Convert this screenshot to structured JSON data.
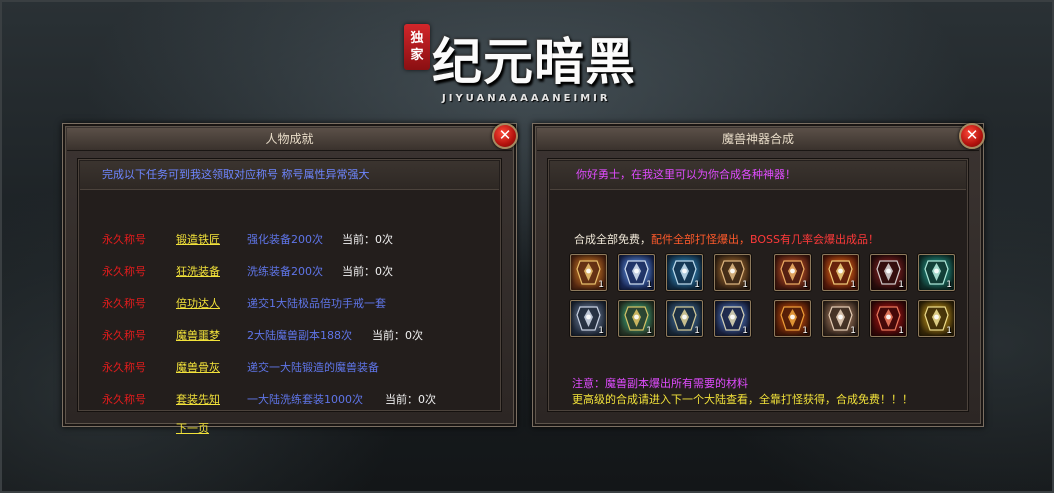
{
  "logo": {
    "seal_1": "独",
    "seal_2": "家",
    "title": "纪元暗黑",
    "subtitle": "JIYUANAAAAANEIMIR"
  },
  "close_glyph": "✕",
  "achievements_panel": {
    "title": "人物成就",
    "banner": "完成以下任务可到我这领取对应称号 称号属性异常强大",
    "rows": [
      {
        "title": "永久称号",
        "name": "锻造铁匠",
        "desc": "强化装备200次",
        "progress": "当前：0次"
      },
      {
        "title": "永久称号",
        "name": "狂洗装备",
        "desc": "洗练装备200次",
        "progress": "当前：0次"
      },
      {
        "title": "永久称号",
        "name": "倍功达人",
        "desc": "递交1大陆极品倍功手戒一套",
        "progress": ""
      },
      {
        "title": "永久称号",
        "name": "魔兽噩梦",
        "desc": "2大陆魔兽副本188次",
        "progress": "当前：0次"
      },
      {
        "title": "永久称号",
        "name": "魔兽骨灰",
        "desc": "递交一大陆锻造的魔兽装备",
        "progress": ""
      },
      {
        "title": "永久称号",
        "name": "套装先知",
        "desc": "一大陆洗练套装1000次",
        "progress": "当前：0次"
      }
    ],
    "next_page": "下一页"
  },
  "synthesis_panel": {
    "title": "魔兽神器合成",
    "banner": "你好勇士，在我这里可以为你合成各种神器！",
    "free_text_a": "合成全部免费，",
    "free_text_b": "配件全部打怪爆出，",
    "free_text_c": "BOSS有几率会爆出成品！",
    "items": [
      {
        "icon": "armor-icon",
        "count": "1"
      },
      {
        "icon": "sword-icon",
        "count": "1"
      },
      {
        "icon": "blade-icon",
        "count": "1"
      },
      {
        "icon": "gauntlet-icon",
        "count": "1"
      },
      {
        "icon": "chestplate-icon",
        "count": "1"
      },
      {
        "icon": "flame-armor-icon",
        "count": "1"
      },
      {
        "icon": "claw-icon",
        "count": "1"
      },
      {
        "icon": "axe-icon",
        "count": "1"
      },
      {
        "icon": "plate-armor-icon",
        "count": "1"
      },
      {
        "icon": "amulet-icon",
        "count": "1"
      },
      {
        "icon": "greatsword-icon",
        "count": "1"
      },
      {
        "icon": "glaive-icon",
        "count": "1"
      },
      {
        "icon": "dragon-armor-icon",
        "count": "1"
      },
      {
        "icon": "helm-icon",
        "count": "1"
      },
      {
        "icon": "demon-claw-icon",
        "count": "1"
      },
      {
        "icon": "golden-armor-icon",
        "count": "1"
      }
    ],
    "note_1": "注意：魔兽副本爆出所有需要的材料",
    "note_2": "更高级的合成请进入下一个大陆查看，全靠打怪获得，合成免费！！！"
  },
  "colors": {
    "title_red": "#e21c1c",
    "name_yellow": "#f2e23a",
    "desc_blue": "#5f75e8",
    "purple": "#e04cff",
    "orange": "#ff5a2b"
  }
}
